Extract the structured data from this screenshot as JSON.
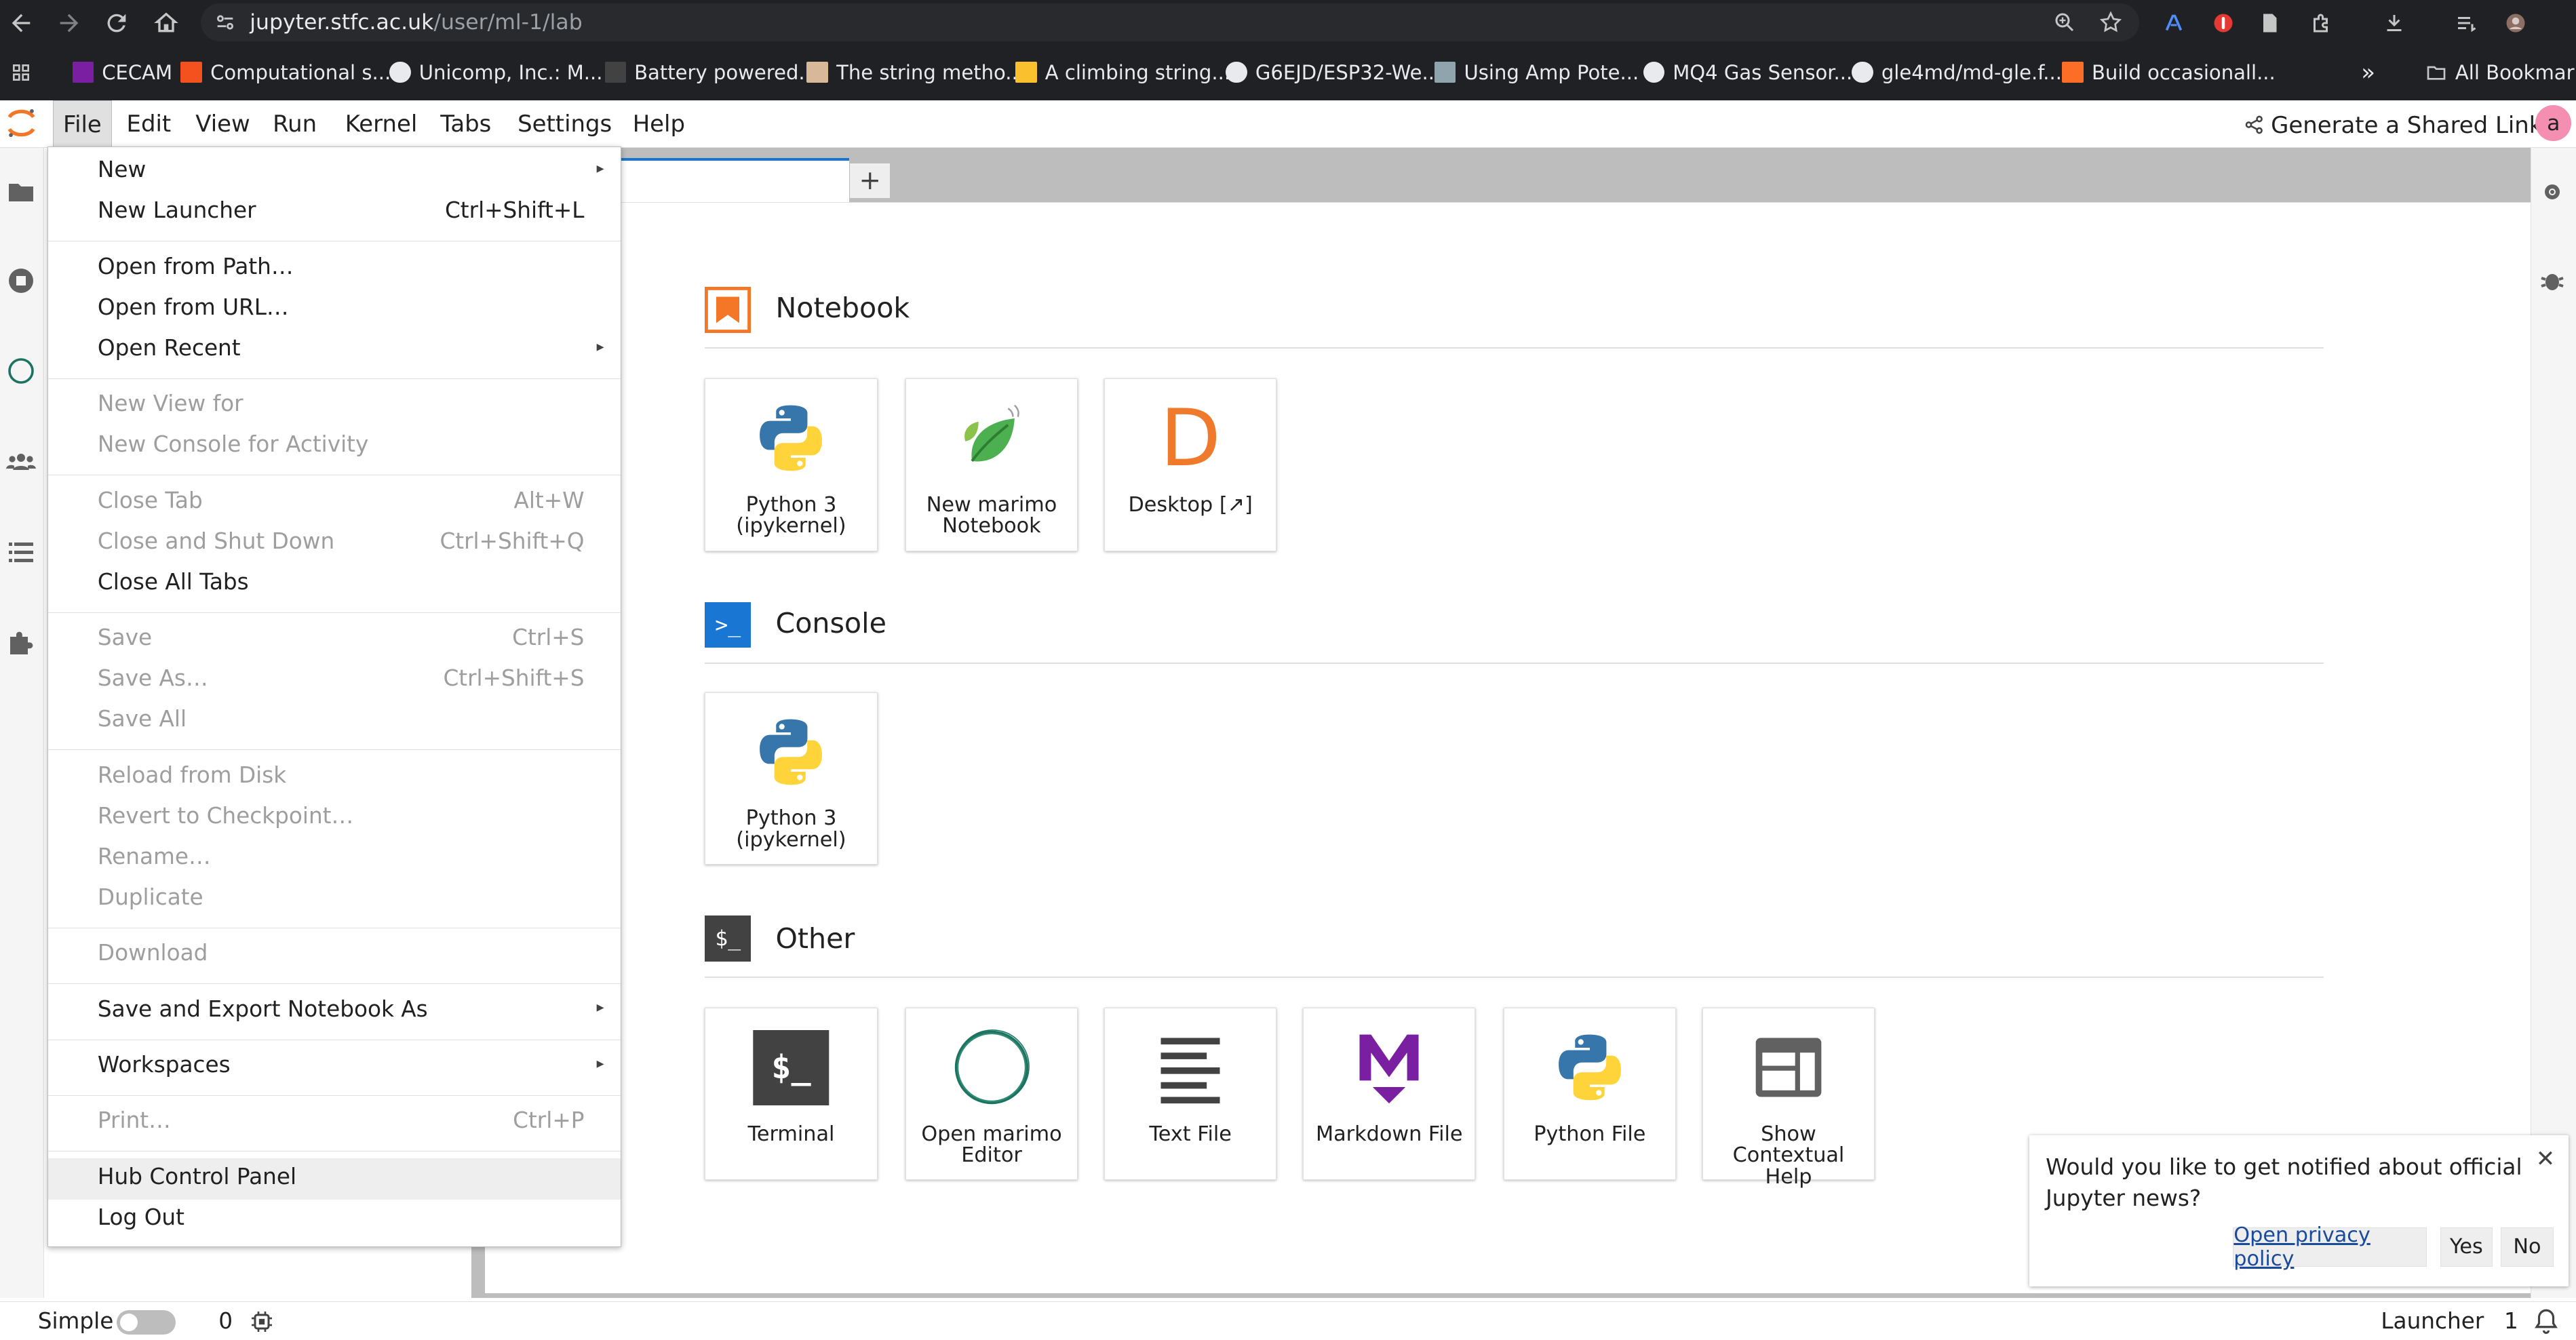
{
  "browser": {
    "url_host": "jupyter.stfc.ac.uk",
    "url_path": "/user/ml-1/lab",
    "bookmarks": [
      {
        "label": "CECAM",
        "color": "#7b1fa2"
      },
      {
        "label": "Computational s...",
        "color": "#f4511e"
      },
      {
        "label": "Unicomp, Inc.: M...",
        "color": "#e8eaed"
      },
      {
        "label": "Battery powered...",
        "color": "#424242"
      },
      {
        "label": "The string metho...",
        "color": "#d7b899"
      },
      {
        "label": "A climbing string...",
        "color": "#fbc02d"
      },
      {
        "label": "G6EJD/ESP32-We...",
        "color": "#e8eaed"
      },
      {
        "label": "Using Amp Pote...",
        "color": "#90a4ae"
      },
      {
        "label": "MQ4 Gas Sensor...",
        "color": "#e8eaed"
      },
      {
        "label": "gle4md/md-gle.f...",
        "color": "#e8eaed"
      },
      {
        "label": "Build occasionall...",
        "color": "#fc6d26"
      }
    ],
    "bookmarks_more": "»",
    "all_bookmarks": "All Bookmarks"
  },
  "menubar": {
    "items": [
      "File",
      "Edit",
      "View",
      "Run",
      "Kernel",
      "Tabs",
      "Settings",
      "Help"
    ],
    "share_label": "Generate a Shared Link",
    "user_initial": "a"
  },
  "tabs": {
    "add_label": "+"
  },
  "launcher": {
    "sections": [
      {
        "title": "Notebook",
        "cards": [
          {
            "label": "Python 3 (ipykernel)",
            "icon": "python-icon"
          },
          {
            "label": "New marimo Notebook",
            "icon": "marimo-leaf-icon"
          },
          {
            "label": "Desktop [↗]",
            "icon": "desktop-d-icon",
            "glyph": "D"
          }
        ]
      },
      {
        "title": "Console",
        "cards": [
          {
            "label": "Python 3 (ipykernel)",
            "icon": "python-icon"
          }
        ]
      },
      {
        "title": "Other",
        "cards": [
          {
            "label": "Terminal",
            "icon": "terminal-icon",
            "glyph": "$_"
          },
          {
            "label": "Open marimo Editor",
            "icon": "marimo-circle-icon"
          },
          {
            "label": "Text File",
            "icon": "text-file-icon"
          },
          {
            "label": "Markdown File",
            "icon": "markdown-icon",
            "glyph": "M"
          },
          {
            "label": "Python File",
            "icon": "python-icon"
          },
          {
            "label": "Show Contextual Help",
            "icon": "contextual-help-icon"
          }
        ]
      }
    ],
    "console_icon_glyph": ">_",
    "other_icon_glyph": "$_"
  },
  "file_menu": [
    {
      "label": "New",
      "submenu": true,
      "enabled": true
    },
    {
      "label": "New Launcher",
      "shortcut": "Ctrl+Shift+L",
      "enabled": true
    },
    {
      "sep": true
    },
    {
      "label": "Open from Path…",
      "enabled": true
    },
    {
      "label": "Open from URL…",
      "enabled": true
    },
    {
      "label": "Open Recent",
      "submenu": true,
      "enabled": true
    },
    {
      "sep": true
    },
    {
      "label": "New View for",
      "enabled": false
    },
    {
      "label": "New Console for Activity",
      "enabled": false
    },
    {
      "sep": true
    },
    {
      "label": "Close Tab",
      "shortcut": "Alt+W",
      "enabled": false
    },
    {
      "label": "Close and Shut Down",
      "shortcut": "Ctrl+Shift+Q",
      "enabled": false
    },
    {
      "label": "Close All Tabs",
      "enabled": true
    },
    {
      "sep": true
    },
    {
      "label": "Save",
      "shortcut": "Ctrl+S",
      "enabled": false
    },
    {
      "label": "Save As…",
      "shortcut": "Ctrl+Shift+S",
      "enabled": false
    },
    {
      "label": "Save All",
      "enabled": false
    },
    {
      "sep": true
    },
    {
      "label": "Reload from Disk",
      "enabled": false
    },
    {
      "label": "Revert to Checkpoint…",
      "enabled": false
    },
    {
      "label": "Rename…",
      "enabled": false
    },
    {
      "label": "Duplicate",
      "enabled": false
    },
    {
      "sep": true
    },
    {
      "label": "Download",
      "enabled": false
    },
    {
      "sep": true
    },
    {
      "label": "Save and Export Notebook As",
      "submenu": true,
      "enabled": true
    },
    {
      "sep": true
    },
    {
      "label": "Workspaces",
      "submenu": true,
      "enabled": true
    },
    {
      "sep": true
    },
    {
      "label": "Print…",
      "shortcut": "Ctrl+P",
      "enabled": false
    },
    {
      "sep": true
    },
    {
      "label": "Hub Control Panel",
      "enabled": true,
      "highlight": true
    },
    {
      "label": "Log Out",
      "enabled": true
    }
  ],
  "statusbar": {
    "mode_label": "Simple",
    "kernel_count": "0",
    "right_label": "Launcher",
    "notification_count": "1"
  },
  "notification": {
    "message": "Would you like to get notified about official Jupyter news?",
    "privacy_link": "Open privacy policy",
    "yes_label": "Yes",
    "no_label": "No",
    "close_glyph": "✕"
  },
  "colors": {
    "accent": "#1976d2",
    "jupyter_orange": "#f37726",
    "console_blue": "#1976d2",
    "markdown_purple": "#7b1fa2",
    "user_avatar": "#f48fb1"
  }
}
